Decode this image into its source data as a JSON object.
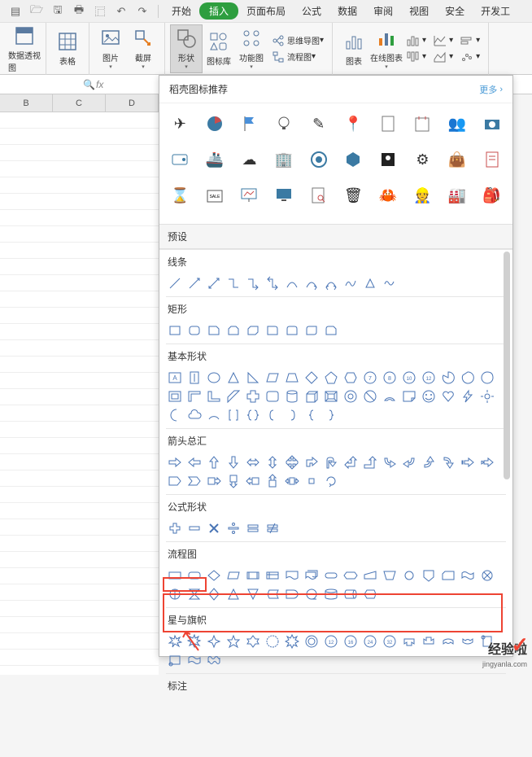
{
  "topbar": {
    "icons": [
      "menu-icon",
      "folder-icon",
      "save-icon",
      "print-icon",
      "preview-icon",
      "undo-icon",
      "redo-icon"
    ]
  },
  "tabs": {
    "items": [
      "开始",
      "插入",
      "页面布局",
      "公式",
      "数据",
      "审阅",
      "视图",
      "安全",
      "开发工"
    ],
    "active_index": 1
  },
  "ribbon": {
    "pivot": "数据透视图",
    "table": "表格",
    "picture": "图片",
    "screenshot": "截屏",
    "shape": "形状",
    "icon_lib": "图标库",
    "feature_map": "功能图",
    "mindmap": "思维导图",
    "flowchart": "流程图",
    "chart": "图表",
    "online_chart": "在线图表"
  },
  "fxbar": {
    "fx": "fx"
  },
  "grid": {
    "cols": [
      "B",
      "C",
      "D"
    ]
  },
  "panel": {
    "recommend_title": "稻壳图标推荐",
    "more": "更多",
    "preset": "预设",
    "lines": "线条",
    "rects": "矩形",
    "basic": "基本形状",
    "arrows": "箭头总汇",
    "formula": "公式形状",
    "flowchart": "流程图",
    "stars": "星与旗帜",
    "callouts": "标注"
  },
  "watermark": {
    "text": "经验啦",
    "sub": "jingyanla.com"
  }
}
